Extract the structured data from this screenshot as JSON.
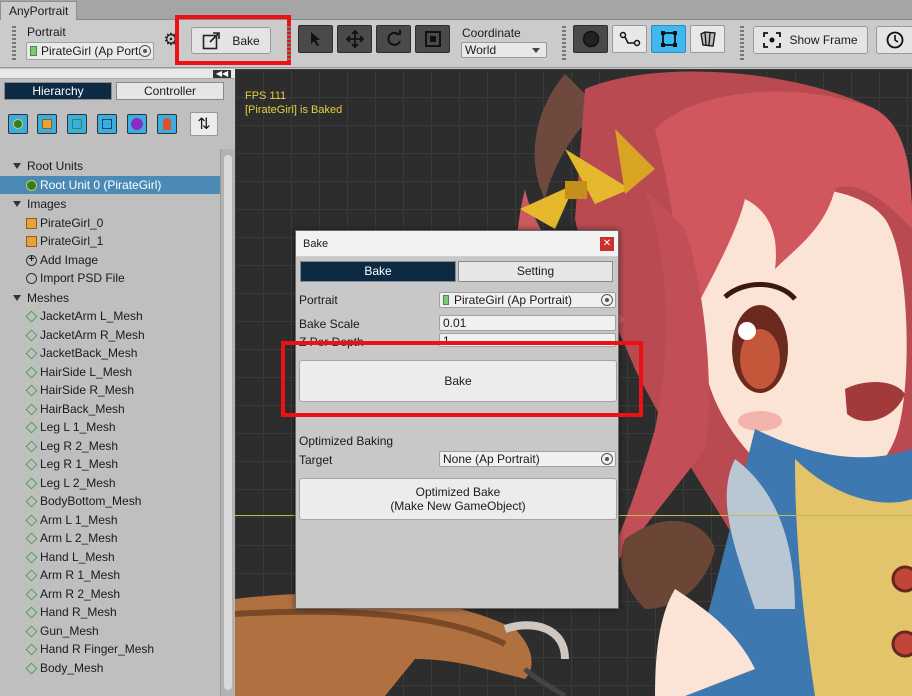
{
  "window": {
    "tab_title": "AnyPortrait"
  },
  "toolbar": {
    "portrait_label": "Portrait",
    "portrait_value": "PirateGirl (Ap Portr",
    "bake_label": "Bake",
    "coordinate_label": "Coordinate",
    "coordinate_value": "World",
    "show_frame_label": "Show Frame"
  },
  "left_panel": {
    "tabs": [
      "Hierarchy",
      "Controller"
    ],
    "sections": [
      {
        "title": "Root Units",
        "items": [
          {
            "label": "Root Unit 0 (PirateGirl)",
            "icon": "root-unit-icon",
            "selected": true
          }
        ]
      },
      {
        "title": "Images",
        "items": [
          {
            "label": "PirateGirl_0",
            "icon": "image-icon"
          },
          {
            "label": "PirateGirl_1",
            "icon": "image-icon"
          },
          {
            "label": "Add Image",
            "icon": "add-icon"
          },
          {
            "label": "Import PSD File",
            "icon": "psd-icon"
          }
        ]
      },
      {
        "title": "Meshes",
        "items": [
          {
            "label": "JacketArm L_Mesh"
          },
          {
            "label": "JacketArm R_Mesh"
          },
          {
            "label": "JacketBack_Mesh"
          },
          {
            "label": "HairSide L_Mesh"
          },
          {
            "label": "HairSide R_Mesh"
          },
          {
            "label": "HairBack_Mesh"
          },
          {
            "label": "Leg L 1_Mesh"
          },
          {
            "label": "Leg R 2_Mesh"
          },
          {
            "label": "Leg R 1_Mesh"
          },
          {
            "label": "Leg L 2_Mesh"
          },
          {
            "label": "BodyBottom_Mesh"
          },
          {
            "label": "Arm L 1_Mesh"
          },
          {
            "label": "Arm L 2_Mesh"
          },
          {
            "label": "Hand L_Mesh"
          },
          {
            "label": "Arm R 1_Mesh"
          },
          {
            "label": "Arm R 2_Mesh"
          },
          {
            "label": "Hand R_Mesh"
          },
          {
            "label": "Gun_Mesh"
          },
          {
            "label": "Hand R Finger_Mesh"
          },
          {
            "label": "Body_Mesh"
          }
        ]
      }
    ]
  },
  "viewport": {
    "fps_text": "FPS 111",
    "status_text": "[PirateGirl] is Baked"
  },
  "bake_dialog": {
    "title": "Bake",
    "tabs": [
      "Bake",
      "Setting"
    ],
    "portrait_label": "Portrait",
    "portrait_value": "PirateGirl (Ap Portrait)",
    "bake_scale_label": "Bake Scale",
    "bake_scale_value": "0.01",
    "z_per_depth_label": "Z Per Depth",
    "z_per_depth_value": "1",
    "bake_button": "Bake",
    "optimized_heading": "Optimized Baking",
    "target_label": "Target",
    "target_value": "None (Ap Portrait)",
    "optimized_button_line1": "Optimized Bake",
    "optimized_button_line2": "(Make New GameObject)"
  },
  "colors": {
    "highlight": "#ee1111",
    "selected_tab": "#0d2a44",
    "fps_text": "#e6d03c",
    "selected_row": "#4a8ab4"
  }
}
